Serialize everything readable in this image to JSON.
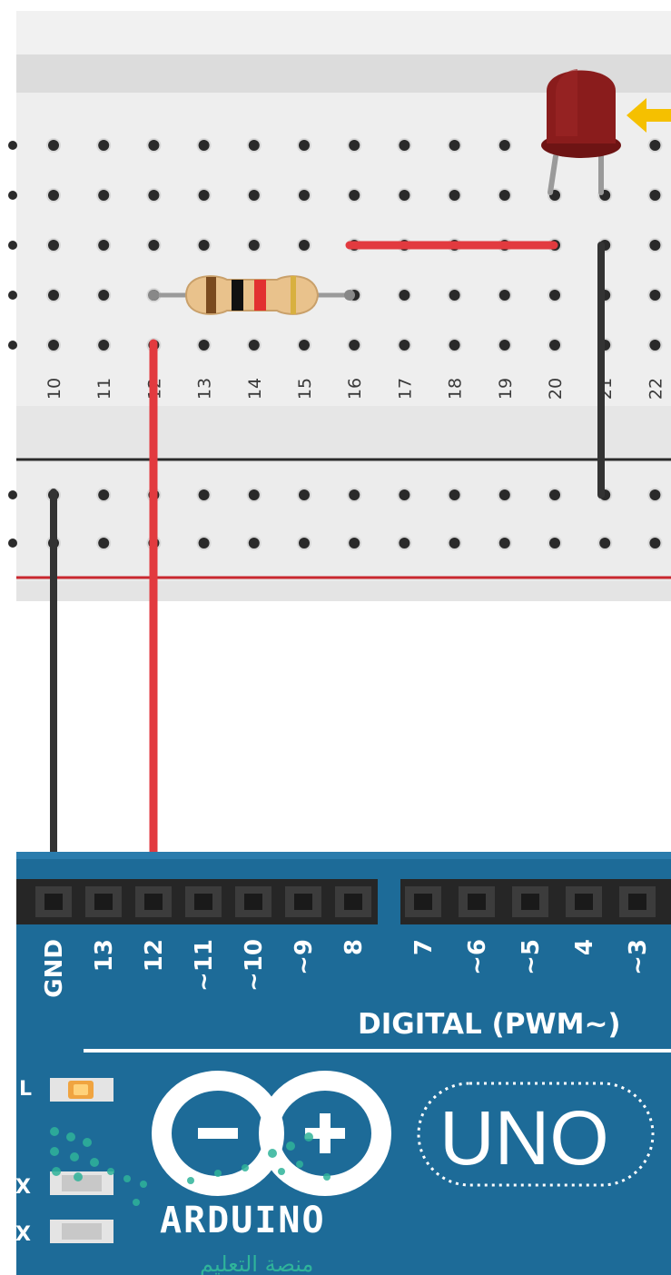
{
  "breadboard": {
    "column_labels": [
      "10",
      "11",
      "12",
      "13",
      "14",
      "15",
      "16",
      "17",
      "18",
      "19",
      "20",
      "21",
      "22"
    ]
  },
  "arduino": {
    "header_left_pins": [
      "GND",
      "13",
      "12",
      "~11",
      "~10",
      "~9",
      "8"
    ],
    "header_right_pins": [
      "7",
      "~6",
      "~5",
      "4",
      "~3"
    ],
    "digital_label": "DIGITAL (PWM~)",
    "led_label": "L",
    "tx_label": "X",
    "rx_label": "X",
    "brand": "ARDUINO",
    "model": "UNO"
  },
  "components": {
    "led_color": "#8a1c1c",
    "resistor_bands": [
      "#7a4a1e",
      "#111111",
      "#e23030",
      "#d8b040"
    ],
    "wire_red": "#e23a3f",
    "wire_black": "#333333"
  },
  "watermark": "منصة التعليم"
}
